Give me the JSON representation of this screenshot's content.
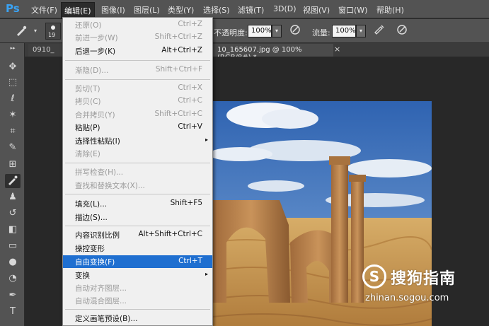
{
  "app": {
    "logo": "Ps"
  },
  "menubar": {
    "items": [
      {
        "label": "文件(F)"
      },
      {
        "label": "编辑(E)"
      },
      {
        "label": "图像(I)"
      },
      {
        "label": "图层(L)"
      },
      {
        "label": "类型(Y)"
      },
      {
        "label": "选择(S)"
      },
      {
        "label": "滤镜(T)"
      },
      {
        "label": "3D(D)"
      },
      {
        "label": "视图(V)"
      },
      {
        "label": "窗口(W)"
      },
      {
        "label": "帮助(H)"
      }
    ]
  },
  "options": {
    "brush_size": "19",
    "opacity_label": "不透明度:",
    "opacity_value": "100%",
    "flow_label": "流量:",
    "flow_value": "100%"
  },
  "tabs": [
    {
      "label": "0910_"
    },
    {
      "label": "10_165607.jpg @ 100%(RGB/8#) *"
    },
    {
      "close": "×"
    }
  ],
  "edit_menu": {
    "items": [
      {
        "label": "还原(O)",
        "shortcut": "Ctrl+Z",
        "disabled": true
      },
      {
        "label": "前进一步(W)",
        "shortcut": "Shift+Ctrl+Z",
        "disabled": true
      },
      {
        "label": "后退一步(K)",
        "shortcut": "Alt+Ctrl+Z",
        "disabled": false
      },
      {
        "label": "渐隐(D)...",
        "shortcut": "Shift+Ctrl+F",
        "disabled": true
      },
      {
        "label": "剪切(T)",
        "shortcut": "Ctrl+X",
        "disabled": true
      },
      {
        "label": "拷贝(C)",
        "shortcut": "Ctrl+C",
        "disabled": true
      },
      {
        "label": "合并拷贝(Y)",
        "shortcut": "Shift+Ctrl+C",
        "disabled": true
      },
      {
        "label": "粘贴(P)",
        "shortcut": "Ctrl+V",
        "disabled": false
      },
      {
        "label": "选择性粘贴(I)",
        "shortcut": "",
        "disabled": false,
        "submenu": true
      },
      {
        "label": "清除(E)",
        "shortcut": "",
        "disabled": true
      },
      {
        "label": "拼写检查(H)...",
        "shortcut": "",
        "disabled": true
      },
      {
        "label": "查找和替换文本(X)...",
        "shortcut": "",
        "disabled": true
      },
      {
        "label": "填充(L)...",
        "shortcut": "Shift+F5",
        "disabled": false
      },
      {
        "label": "描边(S)...",
        "shortcut": "",
        "disabled": false
      },
      {
        "label": "内容识别比例",
        "shortcut": "Alt+Shift+Ctrl+C",
        "disabled": false
      },
      {
        "label": "操控变形",
        "shortcut": "",
        "disabled": false
      },
      {
        "label": "自由变换(F)",
        "shortcut": "Ctrl+T",
        "disabled": false,
        "highlighted": true
      },
      {
        "label": "变换",
        "shortcut": "",
        "disabled": false,
        "submenu": true
      },
      {
        "label": "自动对齐图层...",
        "shortcut": "",
        "disabled": true
      },
      {
        "label": "自动混合图层...",
        "shortcut": "",
        "disabled": true
      },
      {
        "label": "定义画笔预设(B)...",
        "shortcut": "",
        "disabled": false
      }
    ],
    "submenu_arrow": "▸"
  },
  "watermark": {
    "logo_letter": "S",
    "brand": "搜狗指南",
    "url": "zhinan.sogou.com"
  },
  "colors": {
    "menu_highlight": "#1f6fd0",
    "panel": "#535353",
    "sky": "#3d74c0",
    "sand": "#c99a52"
  }
}
